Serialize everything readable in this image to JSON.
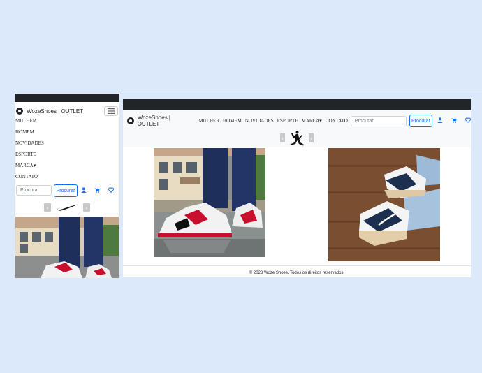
{
  "brand": {
    "name": "WozeShoes | OUTLET"
  },
  "nav": {
    "items": [
      {
        "label": "MULHER"
      },
      {
        "label": "HOMEM"
      },
      {
        "label": "NOVIDADES"
      },
      {
        "label": "ESPORTE"
      },
      {
        "label": "MARCA"
      },
      {
        "label": "CONTATO"
      }
    ],
    "dropdown_caret": "▾"
  },
  "search": {
    "placeholder": "Procurar",
    "button_label": "Procurar"
  },
  "icons": {
    "user": "user-icon",
    "cart": "cart-icon",
    "heart": "heart-icon",
    "menu": "hamburger-menu-icon"
  },
  "carousel": {
    "prev": "‹",
    "next": "›"
  },
  "footer": {
    "copyright": "© 2023 Woze Shoes. Todos os direitos reservados."
  },
  "colors": {
    "accent": "#0d6efd",
    "dark": "#212529",
    "page_bg": "#dce9fb"
  }
}
